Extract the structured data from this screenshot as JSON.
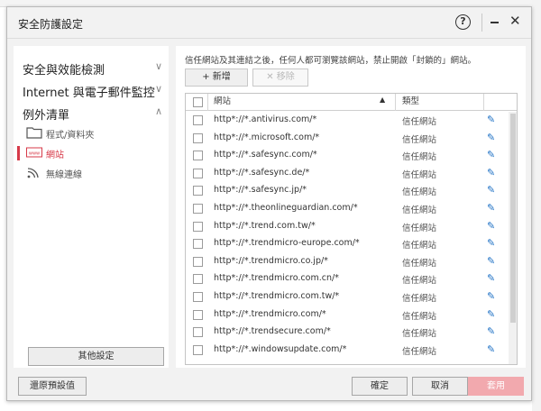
{
  "window": {
    "title": "安全防護設定",
    "help_label": "?",
    "close_label": "✕"
  },
  "sidebar": {
    "categories": [
      {
        "label": "安全與效能檢測",
        "chevron": "∨"
      },
      {
        "label": "Internet 與電子郵件監控",
        "chevron": "∨"
      },
      {
        "label": "例外清單",
        "chevron": "∧"
      }
    ],
    "items": [
      {
        "label": "程式/資料夾",
        "icon": "folder-icon"
      },
      {
        "label": "網站",
        "icon": "www-icon",
        "active": true
      },
      {
        "label": "無線連線",
        "icon": "wifi-icon"
      }
    ],
    "other_settings_label": "其他設定"
  },
  "main": {
    "description": "信任網站及其連結之後，任何人都可瀏覽該網站，禁止開啟「封鎖的」網站。",
    "add_label": "+ 新增",
    "remove_label": "✕ 移除",
    "columns": {
      "site": "網站",
      "type": "類型"
    },
    "rows": [
      {
        "site": "http*://*.antivirus.com/*",
        "type": "信任網站"
      },
      {
        "site": "http*://*.microsoft.com/*",
        "type": "信任網站"
      },
      {
        "site": "http*://*.safesync.com/*",
        "type": "信任網站"
      },
      {
        "site": "http*://*.safesync.de/*",
        "type": "信任網站"
      },
      {
        "site": "http*://*.safesync.jp/*",
        "type": "信任網站"
      },
      {
        "site": "http*://*.theonlineguardian.com/*",
        "type": "信任網站"
      },
      {
        "site": "http*://*.trend.com.tw/*",
        "type": "信任網站"
      },
      {
        "site": "http*://*.trendmicro-europe.com/*",
        "type": "信任網站"
      },
      {
        "site": "http*://*.trendmicro.co.jp/*",
        "type": "信任網站"
      },
      {
        "site": "http*://*.trendmicro.com.cn/*",
        "type": "信任網站"
      },
      {
        "site": "http*://*.trendmicro.com.tw/*",
        "type": "信任網站"
      },
      {
        "site": "http*://*.trendmicro.com/*",
        "type": "信任網站"
      },
      {
        "site": "http*://*.trendsecure.com/*",
        "type": "信任網站"
      },
      {
        "site": "http*://*.windowsupdate.com/*",
        "type": "信任網站"
      }
    ]
  },
  "footer": {
    "restore_label": "還原預設值",
    "ok_label": "確定",
    "cancel_label": "取消",
    "apply_label": "套用"
  },
  "colors": {
    "accent": "#d73a49",
    "edit_icon": "#1b6fc4",
    "apply_disabled": "#f2a9ae"
  }
}
